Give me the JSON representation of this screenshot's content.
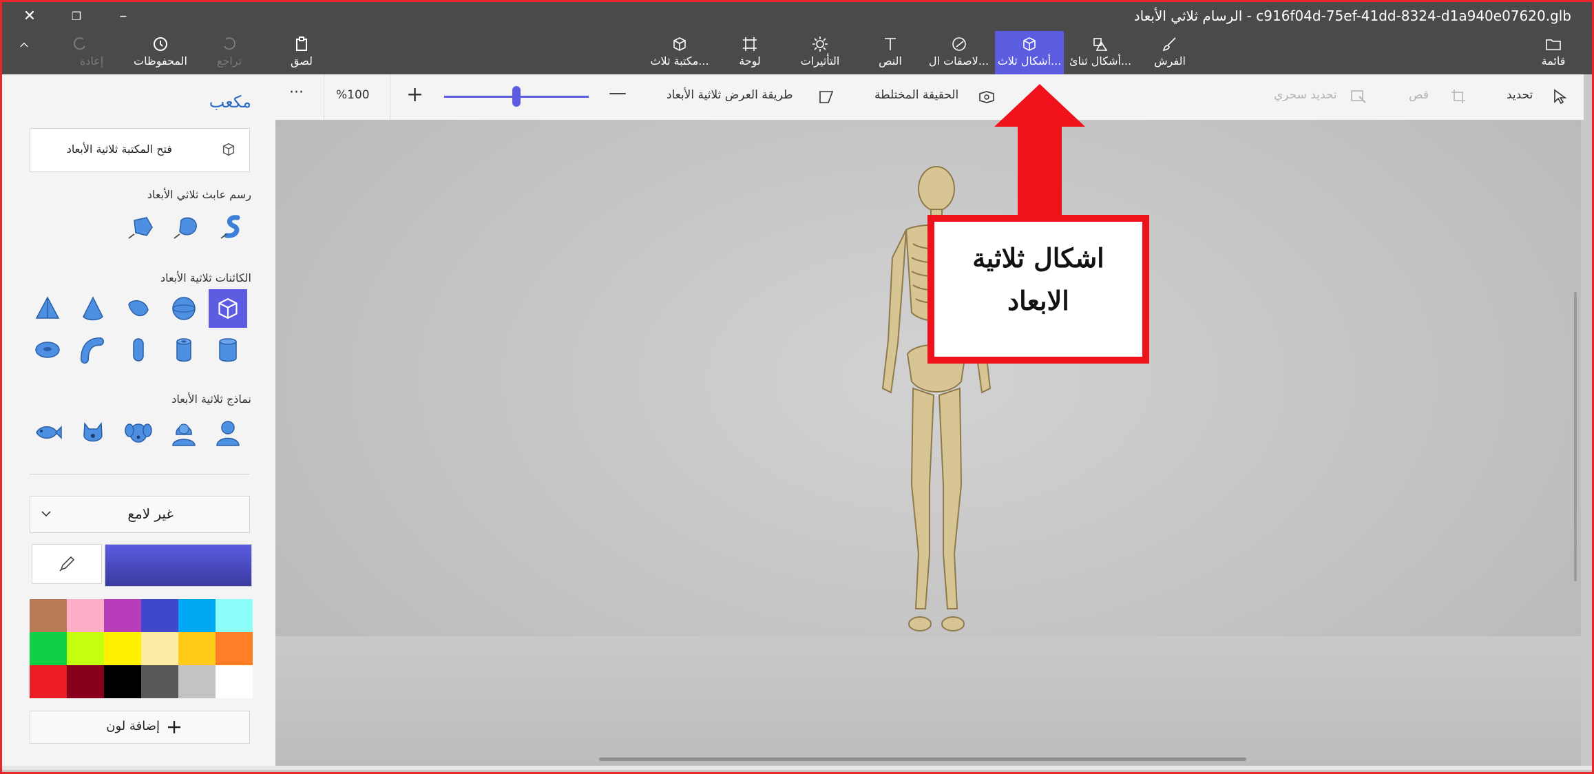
{
  "window": {
    "title": "c916f04d-75ef-41dd-8324-d1a940e07620.glb - الرسام ثلاثي الأبعاد"
  },
  "ribbon": {
    "menu_label": "قائمة",
    "brushes_label": "الفرش",
    "shapes2d_label": "أشكال ثنائ...",
    "shapes3d_label": "أشكال ثلاث...",
    "stickers_label": "لاصقات ال...",
    "text_label": "النص",
    "effects_label": "التأثيرات",
    "canvas_label": "لوحة",
    "library_label": "مكتبة ثلاث...",
    "paste_label": "لصق",
    "undo_label": "تراجع",
    "history_label": "المحفوظات",
    "redo_label": "إعادة"
  },
  "toolbar": {
    "select_label": "تحديد",
    "crop_label": "قص",
    "magic_select_label": "تحديد سحري",
    "mixed_reality_label": "الحقيقة المختلطة",
    "view_3d_label": "طريقة العرض ثلاثية الأبعاد",
    "zoom_value": "%100",
    "more_label": "···",
    "zoom_level": 0.5
  },
  "panel": {
    "title": "مكعب",
    "open_library_label": "فتح المكتبة ثلاثية الأبعاد",
    "doodle_label": "رسم عابث ثلاثي الأبعاد",
    "objects_label": "الكائنات ثلاثية الأبعاد",
    "models_label": "نماذج ثلاثية الأبعاد",
    "material_label": "غير لامع",
    "add_color_label": "إضافة لون",
    "selected_color": "#5b5ce0",
    "swatches": [
      "#ffffff",
      "#c3c3c3",
      "#585858",
      "#000000",
      "#88001b",
      "#ec1c24",
      "#ff7f27",
      "#ffca18",
      "#fdeca6",
      "#fff200",
      "#c4ff0e",
      "#0ed145",
      "#8cfffb",
      "#00a8f3",
      "#3f48cc",
      "#b83dba",
      "#ffaec8",
      "#b97a56"
    ]
  },
  "annotation": {
    "line1": "اشكال ثلاثية",
    "line2": "الابعاد",
    "color": "#f0121a"
  }
}
